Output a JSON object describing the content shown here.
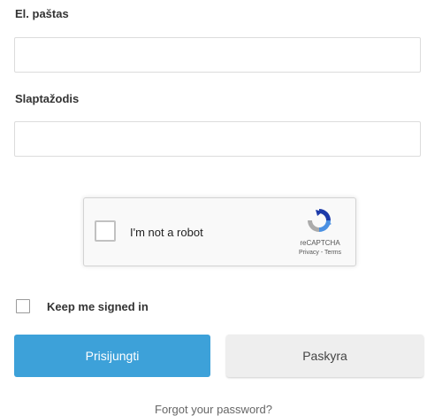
{
  "form": {
    "email_label": "El. paštas",
    "email_value": "",
    "password_label": "Slaptažodis",
    "password_value": "",
    "keep_signed_in_label": "Keep me signed in",
    "keep_signed_in_checked": false,
    "login_button": "Prisijungti",
    "account_button": "Paskyra",
    "forgot_link": "Forgot your password?"
  },
  "recaptcha": {
    "label": "I'm not a robot",
    "brand": "reCAPTCHA",
    "links": "Privacy - Terms",
    "checked": false,
    "logo_icon": "recaptcha-logo-icon"
  },
  "colors": {
    "primary_button": "#3da1d9",
    "secondary_button": "#eeeeee",
    "field_border": "#dcdcdc"
  }
}
